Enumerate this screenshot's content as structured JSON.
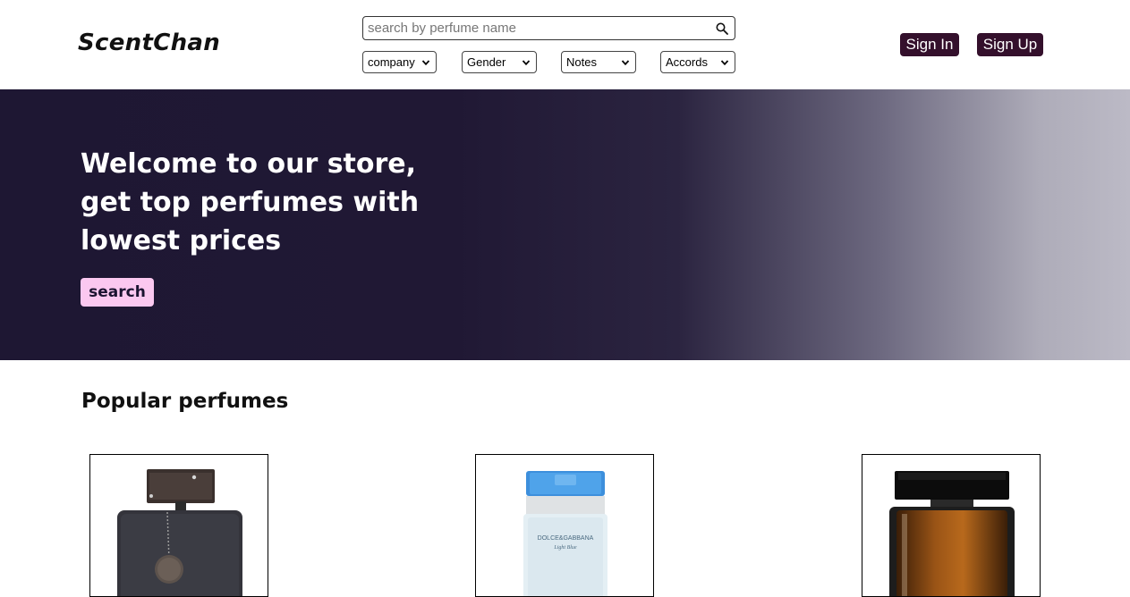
{
  "header": {
    "logo": "ScentChan",
    "search": {
      "placeholder": "search by perfume name",
      "value": ""
    },
    "filters": [
      {
        "label": "company"
      },
      {
        "label": "Gender"
      },
      {
        "label": "Notes"
      },
      {
        "label": "Accords"
      }
    ],
    "sign_in": "Sign In",
    "sign_up": "Sign Up",
    "accent_color": "#34102c"
  },
  "hero": {
    "title": "Welcome to our store, get top perfumes with lowest prices",
    "button": "search",
    "button_color": "#fbc8f0",
    "bg_color": "#1e1733"
  },
  "popular": {
    "title": "Popular perfumes",
    "products": [
      {
        "image": "dark-perfume-bottle-icon"
      },
      {
        "image": "light-blue-perfume-bottle-icon",
        "label_line1": "DOLCE&GABBANA",
        "label_line2": "Light Blue"
      },
      {
        "image": "amber-perfume-bottle-icon"
      }
    ]
  }
}
